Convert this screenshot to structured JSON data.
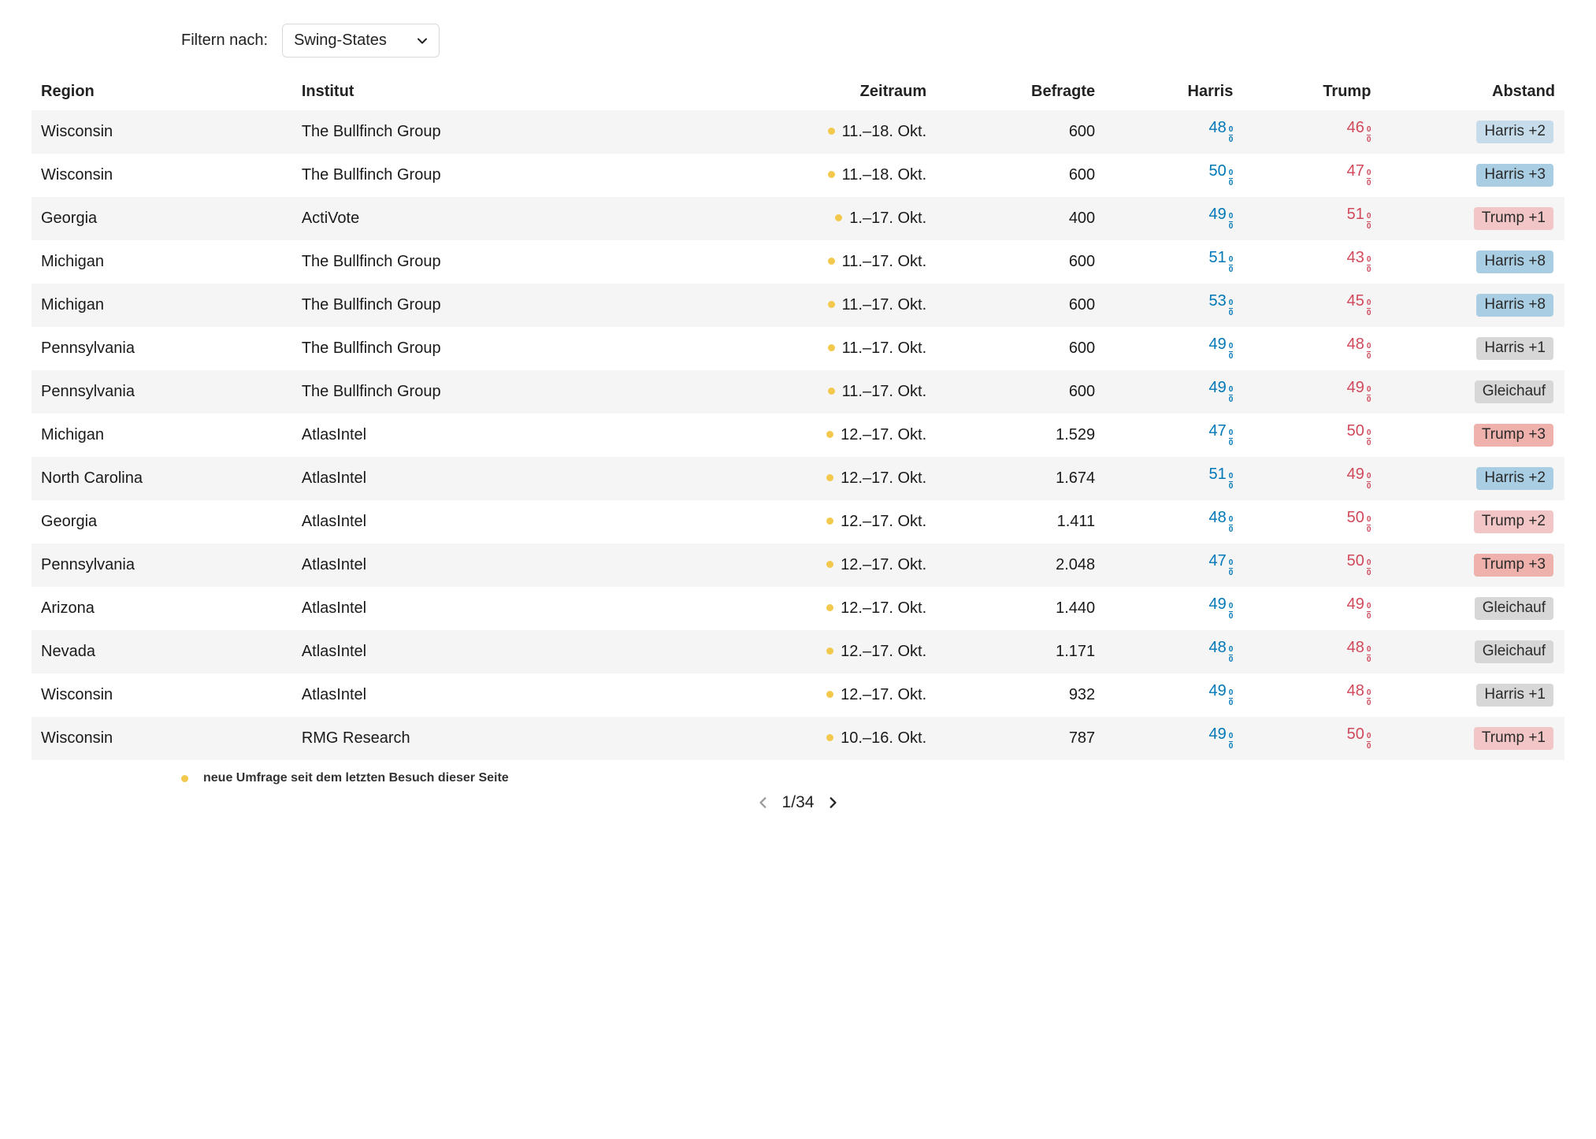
{
  "filter": {
    "label": "Filtern nach:",
    "value": "Swing-States"
  },
  "headers": {
    "region": "Region",
    "institut": "Institut",
    "period": "Zeitraum",
    "befragte": "Befragte",
    "harris": "Harris",
    "trump": "Trump",
    "abstand": "Abstand"
  },
  "percent": {
    "n": "0",
    "d": "0"
  },
  "rows": [
    {
      "region": "Wisconsin",
      "institut": "The Bullfinch Group",
      "period": "11.–18. Okt.",
      "new": true,
      "befragte": "600",
      "harris": "48",
      "trump": "46",
      "abstand": "Harris +2",
      "tag": "harris"
    },
    {
      "region": "Wisconsin",
      "institut": "The Bullfinch Group",
      "period": "11.–18. Okt.",
      "new": true,
      "befragte": "600",
      "harris": "50",
      "trump": "47",
      "abstand": "Harris +3",
      "tag": "harris-s"
    },
    {
      "region": "Georgia",
      "institut": "ActiVote",
      "period": "1.–17. Okt.",
      "new": true,
      "befragte": "400",
      "harris": "49",
      "trump": "51",
      "abstand": "Trump +1",
      "tag": "trump"
    },
    {
      "region": "Michigan",
      "institut": "The Bullfinch Group",
      "period": "11.–17. Okt.",
      "new": true,
      "befragte": "600",
      "harris": "51",
      "trump": "43",
      "abstand": "Harris +8",
      "tag": "harris-s"
    },
    {
      "region": "Michigan",
      "institut": "The Bullfinch Group",
      "period": "11.–17. Okt.",
      "new": true,
      "befragte": "600",
      "harris": "53",
      "trump": "45",
      "abstand": "Harris +8",
      "tag": "harris-s"
    },
    {
      "region": "Pennsylvania",
      "institut": "The Bullfinch Group",
      "period": "11.–17. Okt.",
      "new": true,
      "befragte": "600",
      "harris": "49",
      "trump": "48",
      "abstand": "Harris +1",
      "tag": "tie"
    },
    {
      "region": "Pennsylvania",
      "institut": "The Bullfinch Group",
      "period": "11.–17. Okt.",
      "new": true,
      "befragte": "600",
      "harris": "49",
      "trump": "49",
      "abstand": "Gleichauf",
      "tag": "tie"
    },
    {
      "region": "Michigan",
      "institut": "AtlasIntel",
      "period": "12.–17. Okt.",
      "new": true,
      "befragte": "1.529",
      "harris": "47",
      "trump": "50",
      "abstand": "Trump +3",
      "tag": "trump-s"
    },
    {
      "region": "North Carolina",
      "institut": "AtlasIntel",
      "period": "12.–17. Okt.",
      "new": true,
      "befragte": "1.674",
      "harris": "51",
      "trump": "49",
      "abstand": "Harris +2",
      "tag": "harris-s"
    },
    {
      "region": "Georgia",
      "institut": "AtlasIntel",
      "period": "12.–17. Okt.",
      "new": true,
      "befragte": "1.411",
      "harris": "48",
      "trump": "50",
      "abstand": "Trump +2",
      "tag": "trump"
    },
    {
      "region": "Pennsylvania",
      "institut": "AtlasIntel",
      "period": "12.–17. Okt.",
      "new": true,
      "befragte": "2.048",
      "harris": "47",
      "trump": "50",
      "abstand": "Trump +3",
      "tag": "trump-s"
    },
    {
      "region": "Arizona",
      "institut": "AtlasIntel",
      "period": "12.–17. Okt.",
      "new": true,
      "befragte": "1.440",
      "harris": "49",
      "trump": "49",
      "abstand": "Gleichauf",
      "tag": "tie"
    },
    {
      "region": "Nevada",
      "institut": "AtlasIntel",
      "period": "12.–17. Okt.",
      "new": true,
      "befragte": "1.171",
      "harris": "48",
      "trump": "48",
      "abstand": "Gleichauf",
      "tag": "tie"
    },
    {
      "region": "Wisconsin",
      "institut": "AtlasIntel",
      "period": "12.–17. Okt.",
      "new": true,
      "befragte": "932",
      "harris": "49",
      "trump": "48",
      "abstand": "Harris +1",
      "tag": "tie"
    },
    {
      "region": "Wisconsin",
      "institut": "RMG Research",
      "period": "10.–16. Okt.",
      "new": true,
      "befragte": "787",
      "harris": "49",
      "trump": "50",
      "abstand": "Trump +1",
      "tag": "trump"
    }
  ],
  "legend": "neue Umfrage seit dem letzten Besuch dieser Seite",
  "pager": {
    "current": "1",
    "total": "34",
    "sep": "/"
  }
}
